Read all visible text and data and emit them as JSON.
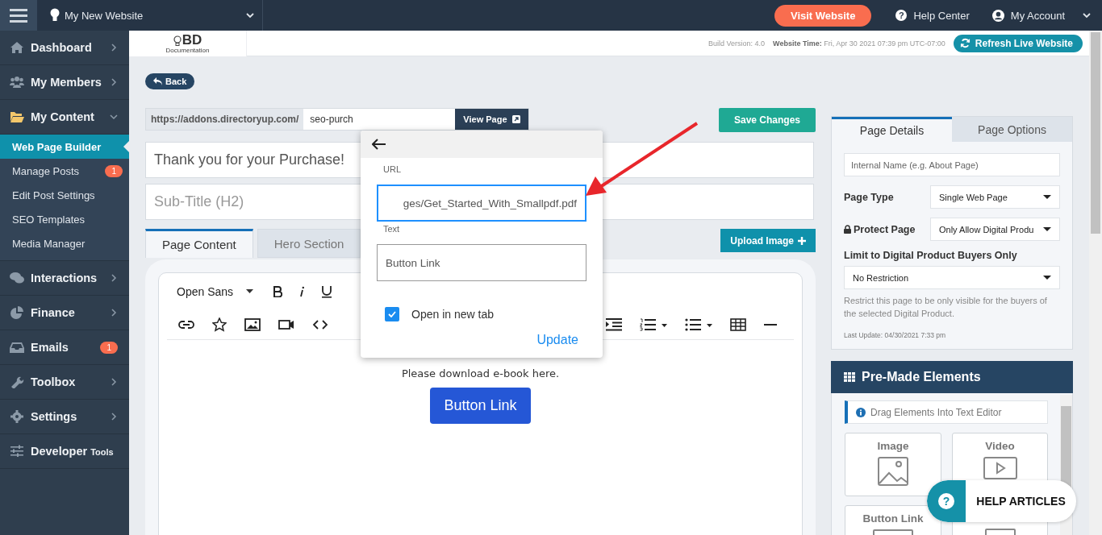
{
  "topbar": {
    "website": "My New Website",
    "visit_button": "Visit Website",
    "help_icon": "?",
    "help": "Help Center",
    "account": "My Account"
  },
  "sidebar": {
    "items": [
      {
        "label": "Dashboard",
        "expanded": false
      },
      {
        "label": "My Members",
        "expanded": false
      },
      {
        "label": "My Content",
        "expanded": true,
        "children": [
          {
            "label": "Web Page Builder",
            "selected": true
          },
          {
            "label": "Manage Posts",
            "selected": false,
            "badge": "1"
          },
          {
            "label": "Edit Post Settings",
            "selected": false
          },
          {
            "label": "SEO Templates",
            "selected": false
          },
          {
            "label": "Media Manager",
            "selected": false
          }
        ]
      },
      {
        "label": "Interactions",
        "expanded": false
      },
      {
        "label": "Finance",
        "expanded": false
      },
      {
        "label": "Emails",
        "badge": "1"
      },
      {
        "label": "Toolbox",
        "expanded": false
      },
      {
        "label": "Settings",
        "expanded": false
      },
      {
        "label": "Developer",
        "suffix": "Tools"
      }
    ]
  },
  "header": {
    "logo": "BD",
    "logo_caption": "Documentation",
    "build": "Build Version: 4.0",
    "time_label": "Website Time:",
    "time": "Fri, Apr 30 2021 07:39 pm UTC-07:00",
    "refresh_button": "Refresh Live Website"
  },
  "back_button": "Back",
  "url_bar": {
    "prefix": "https://addons.directoryup.com/",
    "slug": "seo-purch",
    "view_button": "View Page"
  },
  "save_button": "Save Changes",
  "title_field": {
    "value": "Thank you for your Purchase!"
  },
  "subtitle_field": {
    "placeholder": "Sub-Title (H2)"
  },
  "tabs": [
    {
      "label": "Page Content",
      "selected": true
    },
    {
      "label": "Hero Section",
      "selected": false
    }
  ],
  "upload_button": "Upload Image",
  "editor": {
    "font": "Open Sans",
    "content": "Please download e-book here.",
    "content_button": "Button Link"
  },
  "link_popup": {
    "url_label": "URL",
    "url": "ges/Get_Started_With_Smallpdf.pdf",
    "text_label": "Text",
    "text": "Button Link",
    "new_tab": {
      "label": "Open in new tab",
      "checked": true
    },
    "update": "Update"
  },
  "details": {
    "tabs": [
      {
        "label": "Page Details",
        "selected": true
      },
      {
        "label": "Page Options",
        "selected": false
      }
    ],
    "internal_name": {
      "placeholder": "Internal Name (e.g. About Page)"
    },
    "page_type": {
      "label": "Page Type",
      "value": "Single Web Page"
    },
    "protect": {
      "label": "Protect Page",
      "value": "Only Allow Digital Produ"
    },
    "limit": {
      "label": "Limit to Digital Product Buyers Only",
      "value": "No Restriction",
      "help": "Restrict this page to be only visible for the buyers of the selected Digital Product."
    },
    "last_update": "Last Update: 04/30/2021 7:33 pm"
  },
  "premade": {
    "title": "Pre-Made Elements",
    "info": "Drag Elements Into Text Editor",
    "elements": [
      {
        "label": "Image",
        "kind": "image"
      },
      {
        "label": "Video",
        "kind": "video"
      },
      {
        "label": "Button Link",
        "kind": "button"
      },
      {
        "kind": "box"
      }
    ]
  },
  "help_bubble": {
    "icon": "?",
    "label": "HELP ARTICLES"
  }
}
